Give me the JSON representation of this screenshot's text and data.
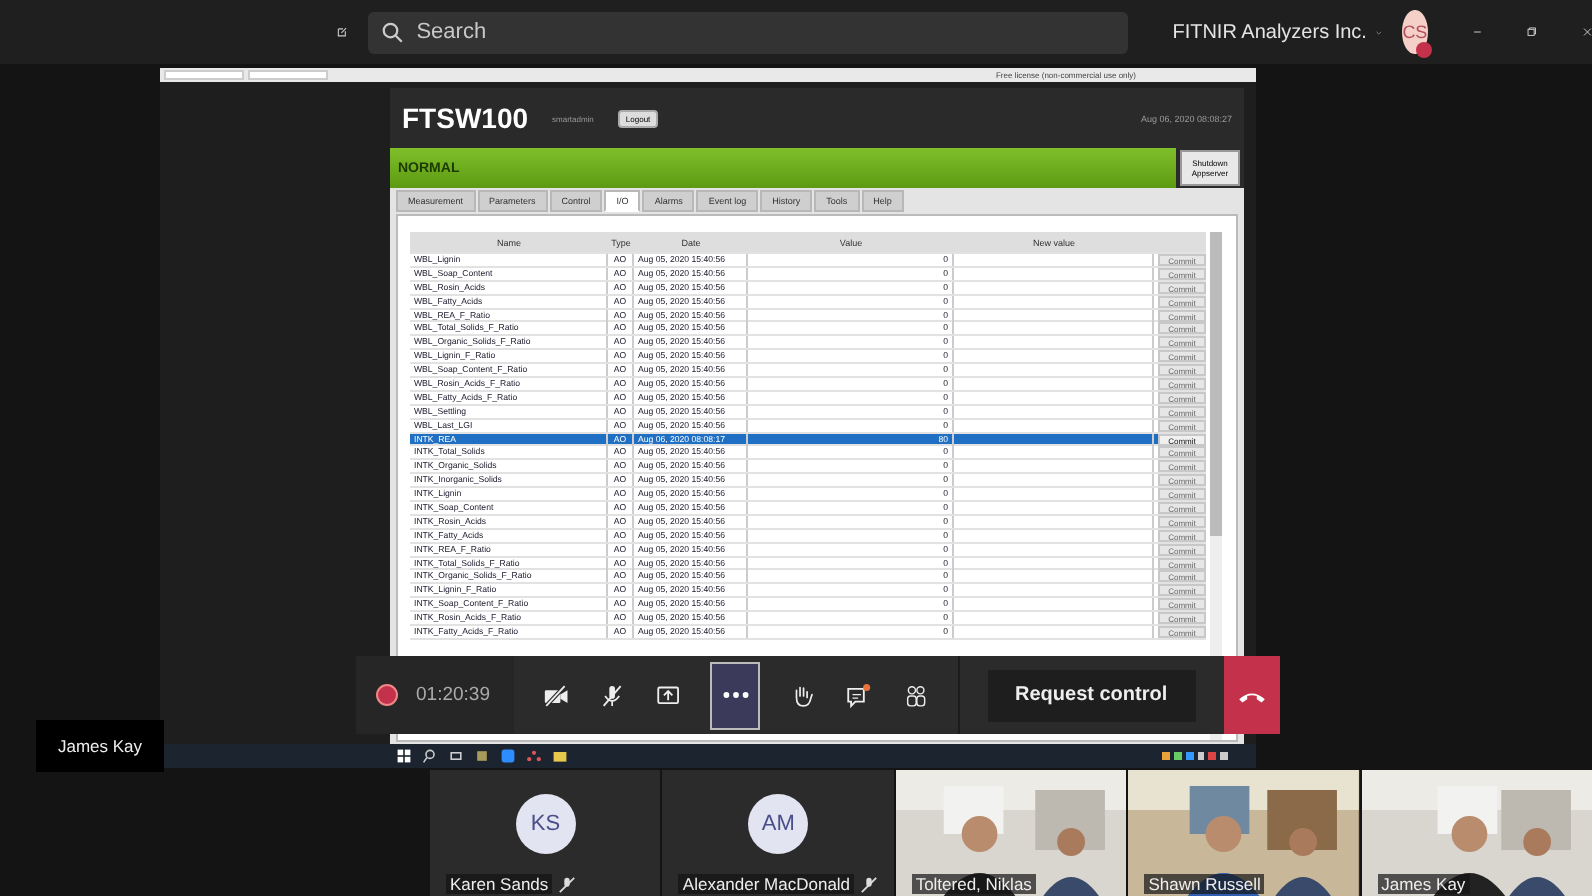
{
  "top_bar": {
    "search": {
      "placeholder": "Search"
    },
    "org": "FITNIR Analyzers Inc.",
    "avatar": "CS"
  },
  "shared_screen": {
    "browser_note": "Free license (non-commercial use only)",
    "app": {
      "title": "FTSW100",
      "user": "smartadmin",
      "logout": "Logout",
      "datetime": "Aug 06, 2020 08:08:27",
      "status": "NORMAL",
      "shutdown": "Shutdown Appserver",
      "tabs": [
        {
          "label": "Measurement",
          "selected": false
        },
        {
          "label": "Parameters",
          "selected": false
        },
        {
          "label": "Control",
          "selected": false
        },
        {
          "label": "I/O",
          "selected": true
        },
        {
          "label": "Alarms",
          "selected": false
        },
        {
          "label": "Event log",
          "selected": false
        },
        {
          "label": "History",
          "selected": false
        },
        {
          "label": "Tools",
          "selected": false
        },
        {
          "label": "Help",
          "selected": false
        }
      ],
      "table": {
        "columns": [
          "Name",
          "Type",
          "Date",
          "Value",
          "New value"
        ],
        "rows": [
          {
            "name": "WBL_Lignin",
            "type": "AO",
            "date": "Aug 05, 2020 15:40:56",
            "value": "0",
            "commit": "Commit",
            "selected": false
          },
          {
            "name": "WBL_Soap_Content",
            "type": "AO",
            "date": "Aug 05, 2020 15:40:56",
            "value": "0",
            "commit": "Commit",
            "selected": false
          },
          {
            "name": "WBL_Rosin_Acids",
            "type": "AO",
            "date": "Aug 05, 2020 15:40:56",
            "value": "0",
            "commit": "Commit",
            "selected": false
          },
          {
            "name": "WBL_Fatty_Acids",
            "type": "AO",
            "date": "Aug 05, 2020 15:40:56",
            "value": "0",
            "commit": "Commit",
            "selected": false
          },
          {
            "name": "WBL_REA_F_Ratio",
            "type": "AO",
            "date": "Aug 05, 2020 15:40:56",
            "value": "0",
            "commit": "Commit",
            "selected": false
          },
          {
            "name": "WBL_Total_Solids_F_Ratio",
            "type": "AO",
            "date": "Aug 05, 2020 15:40:56",
            "value": "0",
            "commit": "Commit",
            "selected": false
          },
          {
            "name": "WBL_Organic_Solids_F_Ratio",
            "type": "AO",
            "date": "Aug 05, 2020 15:40:56",
            "value": "0",
            "commit": "Commit",
            "selected": false
          },
          {
            "name": "WBL_Lignin_F_Ratio",
            "type": "AO",
            "date": "Aug 05, 2020 15:40:56",
            "value": "0",
            "commit": "Commit",
            "selected": false
          },
          {
            "name": "WBL_Soap_Content_F_Ratio",
            "type": "AO",
            "date": "Aug 05, 2020 15:40:56",
            "value": "0",
            "commit": "Commit",
            "selected": false
          },
          {
            "name": "WBL_Rosin_Acids_F_Ratio",
            "type": "AO",
            "date": "Aug 05, 2020 15:40:56",
            "value": "0",
            "commit": "Commit",
            "selected": false
          },
          {
            "name": "WBL_Fatty_Acids_F_Ratio",
            "type": "AO",
            "date": "Aug 05, 2020 15:40:56",
            "value": "0",
            "commit": "Commit",
            "selected": false
          },
          {
            "name": "WBL_Settling",
            "type": "AO",
            "date": "Aug 05, 2020 15:40:56",
            "value": "0",
            "commit": "Commit",
            "selected": false
          },
          {
            "name": "WBL_Last_LGI",
            "type": "AO",
            "date": "Aug 05, 2020 15:40:56",
            "value": "0",
            "commit": "Commit",
            "selected": false
          },
          {
            "name": "INTK_REA",
            "type": "AO",
            "date": "Aug 06, 2020 08:08:17",
            "value": "80",
            "commit": "Commit",
            "selected": true
          },
          {
            "name": "INTK_Total_Solids",
            "type": "AO",
            "date": "Aug 05, 2020 15:40:56",
            "value": "0",
            "commit": "Commit",
            "selected": false
          },
          {
            "name": "INTK_Organic_Solids",
            "type": "AO",
            "date": "Aug 05, 2020 15:40:56",
            "value": "0",
            "commit": "Commit",
            "selected": false
          },
          {
            "name": "INTK_Inorganic_Solids",
            "type": "AO",
            "date": "Aug 05, 2020 15:40:56",
            "value": "0",
            "commit": "Commit",
            "selected": false
          },
          {
            "name": "INTK_Lignin",
            "type": "AO",
            "date": "Aug 05, 2020 15:40:56",
            "value": "0",
            "commit": "Commit",
            "selected": false
          },
          {
            "name": "INTK_Soap_Content",
            "type": "AO",
            "date": "Aug 05, 2020 15:40:56",
            "value": "0",
            "commit": "Commit",
            "selected": false
          },
          {
            "name": "INTK_Rosin_Acids",
            "type": "AO",
            "date": "Aug 05, 2020 15:40:56",
            "value": "0",
            "commit": "Commit",
            "selected": false
          },
          {
            "name": "INTK_Fatty_Acids",
            "type": "AO",
            "date": "Aug 05, 2020 15:40:56",
            "value": "0",
            "commit": "Commit",
            "selected": false
          },
          {
            "name": "INTK_REA_F_Ratio",
            "type": "AO",
            "date": "Aug 05, 2020 15:40:56",
            "value": "0",
            "commit": "Commit",
            "selected": false
          },
          {
            "name": "INTK_Total_Solids_F_Ratio",
            "type": "AO",
            "date": "Aug 05, 2020 15:40:56",
            "value": "0",
            "commit": "Commit",
            "selected": false
          },
          {
            "name": "INTK_Organic_Solids_F_Ratio",
            "type": "AO",
            "date": "Aug 05, 2020 15:40:56",
            "value": "0",
            "commit": "Commit",
            "selected": false
          },
          {
            "name": "INTK_Lignin_F_Ratio",
            "type": "AO",
            "date": "Aug 05, 2020 15:40:56",
            "value": "0",
            "commit": "Commit",
            "selected": false
          },
          {
            "name": "INTK_Soap_Content_F_Ratio",
            "type": "AO",
            "date": "Aug 05, 2020 15:40:56",
            "value": "0",
            "commit": "Commit",
            "selected": false
          },
          {
            "name": "INTK_Rosin_Acids_F_Ratio",
            "type": "AO",
            "date": "Aug 05, 2020 15:40:56",
            "value": "0",
            "commit": "Commit",
            "selected": false
          },
          {
            "name": "INTK_Fatty_Acids_F_Ratio",
            "type": "AO",
            "date": "Aug 05, 2020 15:40:56",
            "value": "0",
            "commit": "Commit",
            "selected": false
          }
        ]
      }
    }
  },
  "presenter_label": "James Kay",
  "call_toolbar": {
    "recording": true,
    "duration": "01:20:39",
    "more_selected": true,
    "chat_unread": true,
    "request_control": "Request control"
  },
  "participants": [
    {
      "kind": "avatar",
      "initials": "KS",
      "name": "Karen Sands",
      "muted": true
    },
    {
      "kind": "avatar",
      "initials": "AM",
      "name": "Alexander MacDonald",
      "muted": true
    },
    {
      "kind": "video",
      "name": "Toltered, Niklas",
      "muted": false
    },
    {
      "kind": "video",
      "name": "Shawn Russell",
      "muted": false
    },
    {
      "kind": "video",
      "name": "James Kay",
      "muted": false
    }
  ]
}
